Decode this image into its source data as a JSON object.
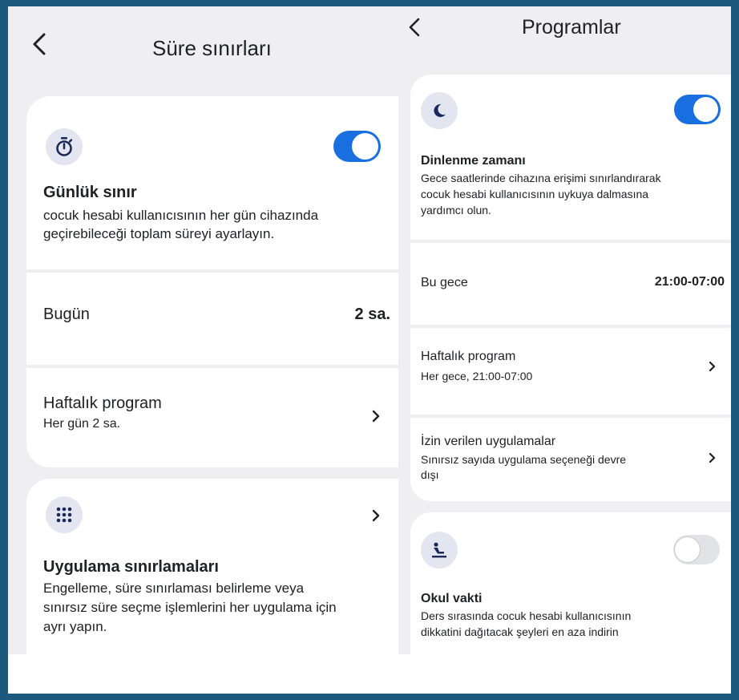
{
  "left": {
    "title": "Süre sınırları",
    "daily_limit": {
      "title": "Günlük sınır",
      "desc_line1": "cocuk hesabi kullanıcısının her gün cihazında",
      "desc_line2": "geçirebileceği toplam süreyi ayarlayın.",
      "enabled": true
    },
    "today": {
      "label": "Bugün",
      "value": "2 sa."
    },
    "weekly": {
      "label": "Haftalık program",
      "sub": "Her gün 2 sa."
    },
    "app_limits": {
      "title": "Uygulama sınırlamaları",
      "desc_line1": "Engelleme, süre sınırlaması belirleme veya",
      "desc_line2": "sınırsız süre seçme işlemlerini her uygulama için",
      "desc_line3": "ayrı yapın."
    }
  },
  "right": {
    "title": "Programlar",
    "downtime": {
      "title": "Dinlenme zamanı",
      "desc_line1": "Gece saatlerinde cihazına erişimi sınırlandırarak",
      "desc_line2": "cocuk hesabi kullanıcısının uykuya dalmasına",
      "desc_line3": "yardımcı olun.",
      "enabled": true
    },
    "tonight": {
      "label": "Bu gece",
      "value": "21:00-07:00"
    },
    "weekly": {
      "label": "Haftalık program",
      "sub": "Her gece, 21:00-07:00"
    },
    "allowed_apps": {
      "label": "İzin verilen uygulamalar",
      "sub_line1": "Sınırsız sayıda uygulama seçeneği devre",
      "sub_line2": "dışı"
    },
    "school_time": {
      "title": "Okul vakti",
      "desc_line1": "Ders sırasında cocuk hesabi kullanıcısının",
      "desc_line2": "dikkatini dağıtacak şeyleri en aza indirin",
      "enabled": false
    }
  },
  "icons": {
    "back": "chevron-left-icon",
    "timer": "stopwatch-icon",
    "apps": "app-grid-icon",
    "moon": "moon-icon",
    "school": "student-desk-icon",
    "chevron": "chevron-right-icon"
  },
  "colors": {
    "accent": "#1a6fe0",
    "border": "#1c5a7d",
    "background": "#efeff2",
    "card": "#ffffff",
    "icon_dark": "#1b2a5c",
    "icon_bg": "#e3e6f0"
  }
}
